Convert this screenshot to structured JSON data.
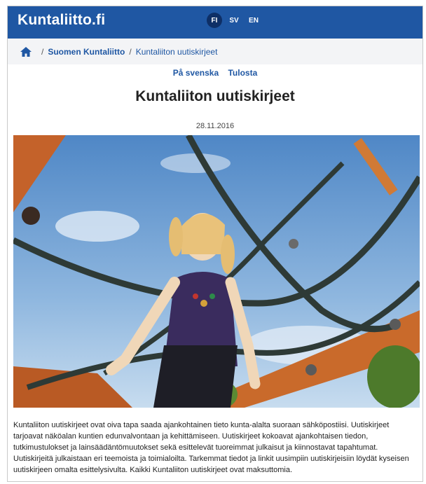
{
  "header": {
    "logo": "Kuntaliitto.fi",
    "languages": [
      {
        "code": "FI",
        "active": true
      },
      {
        "code": "SV",
        "active": false
      },
      {
        "code": "EN",
        "active": false
      }
    ],
    "brand_color": "#1f57a3"
  },
  "breadcrumb": {
    "home_icon": "home-icon",
    "items": [
      "Suomen Kuntaliitto",
      "Kuntaliiton uutiskirjeet"
    ]
  },
  "actions": {
    "swedish": "På svenska",
    "print": "Tulosta"
  },
  "article": {
    "title": "Kuntaliiton uutiskirjeet",
    "date": "28.11.2016",
    "body": "Kuntaliiton uutiskirjeet ovat oiva tapa saada ajankohtainen tieto kunta-alalta suoraan sähköpostiisi. Uutiskirjeet tarjoavat näköalan kuntien edunvalvontaan ja kehittämiseen. Uutiskirjeet kokoavat ajankohtaisen tiedon, tutkimustulokset ja lainsäädäntömuutokset sekä esittelevät tuoreimmat julkaisut ja kiinnostavat tapahtumat. Uutiskirjeitä julkaistaan eri teemoista ja toimialoilta. Tarkemmat tiedot ja linkit uusimpiin uutiskirjeisiin löydät kyseisen uutiskirjeen omalta esittelysivulta. Kaikki Kuntaliiton uutiskirjeet ovat maksuttomia."
  }
}
